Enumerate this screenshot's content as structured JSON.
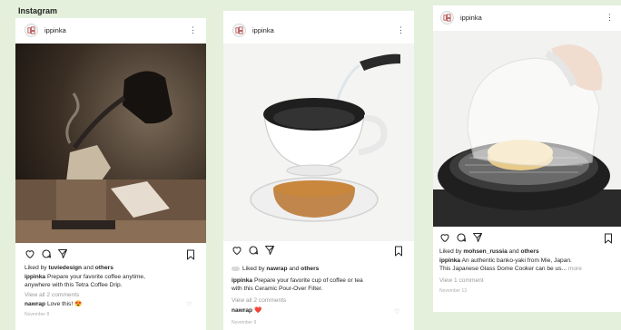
{
  "app_title": "Instagram",
  "posts": [
    {
      "username": "ippinka",
      "more_icon": "⋮",
      "liked_prefix": "Liked by ",
      "liked_user": "tuviedesign",
      "liked_and": " and ",
      "liked_others": "others",
      "caption_user": "ippinka",
      "caption_line1": "Prepare your favorite coffee anytime,",
      "caption_line2": "anywhere with this Tetra Coffee Drip.",
      "view_comments": "View all 2 comments",
      "comment_user": "nawrap",
      "comment_text": "Love this! 😍",
      "date": "November 8"
    },
    {
      "username": "ippinka",
      "more_icon": "⋮",
      "liked_prefix": "Liked by ",
      "liked_user": "nawrap",
      "liked_and": " and ",
      "liked_others": "others",
      "caption_user": "ippinka",
      "caption_line1": "Prepare your favorite cup of coffee or tea",
      "caption_line2": "with this Ceramic Pour-Over Filter.",
      "view_comments": "View all 2 comments",
      "comment_user": "nawrap",
      "comment_text": "❤️",
      "date": "November 9"
    },
    {
      "username": "ippinka",
      "more_icon": "⋮",
      "liked_prefix": "Liked by ",
      "liked_user": "mohsen_russia",
      "liked_and": " and ",
      "liked_others": "others",
      "caption_user": "ippinka",
      "caption_line1": "An authentic banko-yaki from Mie, Japan.",
      "caption_line2": "This Japanese Glass Dome Cooker can be us...",
      "caption_more": "more",
      "view_comments": "View 1 comment",
      "date": "November 13"
    }
  ],
  "colors": {
    "background": "#e4f0dc",
    "like_red": "#e0245e"
  },
  "icons": [
    "heart-icon",
    "comment-icon",
    "share-icon",
    "bookmark-icon",
    "more-icon"
  ]
}
